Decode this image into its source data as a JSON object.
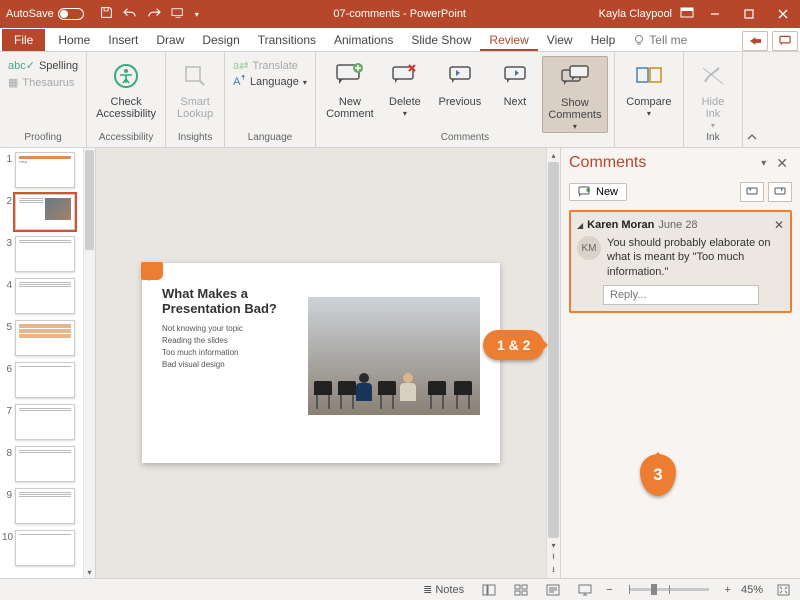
{
  "title": {
    "autosave": "AutoSave",
    "doc": "07-comments - PowerPoint",
    "user": "Kayla Claypool"
  },
  "menu": {
    "file": "File",
    "home": "Home",
    "insert": "Insert",
    "draw": "Draw",
    "design": "Design",
    "transitions": "Transitions",
    "animations": "Animations",
    "slideshow": "Slide Show",
    "review": "Review",
    "view": "View",
    "help": "Help",
    "tell": "Tell me"
  },
  "ribbon": {
    "proofing": {
      "label": "Proofing",
      "spelling": "Spelling",
      "thesaurus": "Thesaurus"
    },
    "accessibility": {
      "label": "Accessibility",
      "check": "Check\nAccessibility"
    },
    "insights": {
      "label": "Insights",
      "smart": "Smart\nLookup"
    },
    "language": {
      "label": "Language",
      "translate": "Translate",
      "lang": "Language"
    },
    "comments": {
      "label": "Comments",
      "new": "New\nComment",
      "delete": "Delete",
      "prev": "Previous",
      "next": "Next",
      "show": "Show\nComments"
    },
    "compare": {
      "compare": "Compare"
    },
    "ink": {
      "label": "Ink",
      "hide": "Hide\nInk"
    }
  },
  "slide": {
    "title": "What Makes a Presentation Bad?",
    "bullets": [
      "Not knowing your topic",
      "Reading the slides",
      "Too much information",
      "Bad visual design"
    ]
  },
  "thumbs": [
    "1",
    "2",
    "3",
    "4",
    "5",
    "6",
    "7",
    "8",
    "9",
    "10"
  ],
  "comments_pane": {
    "title": "Comments",
    "new": "New",
    "author": "Karen Moran",
    "date": "June 28",
    "initials": "KM",
    "text": "You should probably elaborate on what is meant by \"Too much information.\"",
    "reply": "Reply..."
  },
  "callouts": {
    "c12": "1 & 2",
    "c3": "3"
  },
  "status": {
    "notes": "Notes",
    "zoom": "45%"
  }
}
